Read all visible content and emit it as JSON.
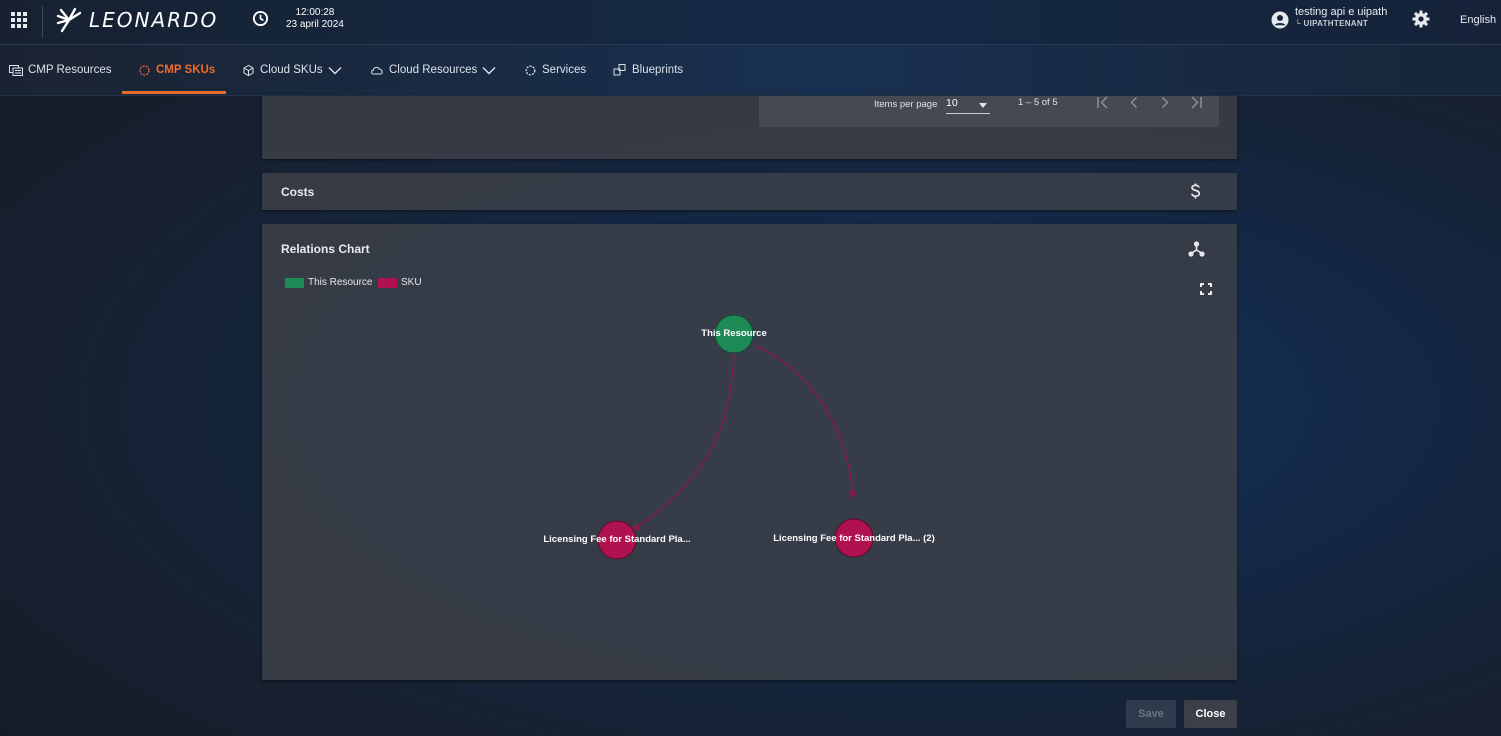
{
  "header": {
    "brand": "LEONARDO",
    "time": "12:00:28",
    "date": "23 april 2024",
    "user_name": "testing api e uipath",
    "user_tenant": "└ UIPATHTENANT",
    "language": "English"
  },
  "nav": {
    "items": [
      {
        "label": "CMP Resources",
        "icon": "resources-icon",
        "active": false
      },
      {
        "label": "CMP SKUs",
        "icon": "sku-icon",
        "active": true
      },
      {
        "label": "Cloud SKUs",
        "icon": "cloud-sku-icon",
        "dropdown": true
      },
      {
        "label": "Cloud Resources",
        "icon": "cloud-icon",
        "dropdown": true
      },
      {
        "label": "Services",
        "icon": "services-icon"
      },
      {
        "label": "Blueprints",
        "icon": "blueprints-icon"
      }
    ],
    "active_color": "#e86a2c"
  },
  "pagination": {
    "items_per_page_label": "Items per page",
    "items_per_page_value": "10",
    "range": "1 – 5 of 5"
  },
  "costs": {
    "title": "Costs",
    "icon": "dollar-icon"
  },
  "relations": {
    "title": "Relations Chart",
    "icon": "hierarchy-icon",
    "legend": [
      {
        "label": "This Resource",
        "color": "#1e8a55"
      },
      {
        "label": "SKU",
        "color": "#b0124f"
      }
    ],
    "nodes": {
      "center": "This Resource",
      "left": "Licensing Fee for Standard Pla...",
      "right": "Licensing Fee for Standard Pla... (2)"
    }
  },
  "footer": {
    "save_label": "Save",
    "close_label": "Close"
  }
}
